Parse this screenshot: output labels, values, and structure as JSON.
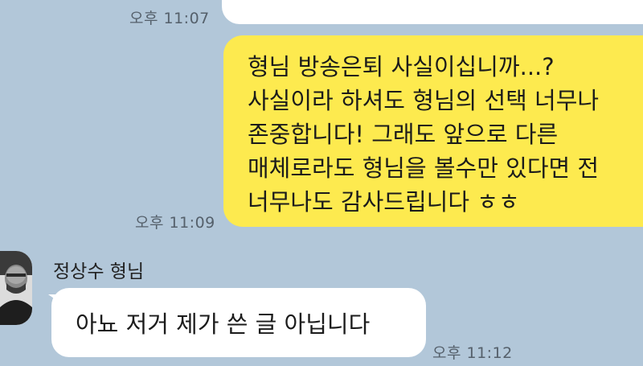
{
  "messages": [
    {
      "direction": "outgoing",
      "time": "오후 11:07"
    },
    {
      "direction": "outgoing",
      "lines": [
        "형님 방송은퇴 사실이십니까...?",
        "사실이라 하셔도 형님의 선택 너무나",
        "존중합니다! 그래도 앞으로 다른",
        "매체로라도 형님을 볼수만 있다면 전",
        "너무나도 감사드립니다 ㅎㅎ"
      ],
      "time": "오후 11:09"
    },
    {
      "direction": "incoming",
      "sender": "정상수 형님",
      "lines": [
        "아뇨 저거 제가 쓴 글 아닙니다"
      ],
      "time": "오후 11:12"
    }
  ],
  "colors": {
    "background": "#b2c7d9",
    "outgoing_bubble": "#fdea4f",
    "incoming_bubble": "#ffffff"
  },
  "icons": {
    "avatar": "profile-photo"
  }
}
